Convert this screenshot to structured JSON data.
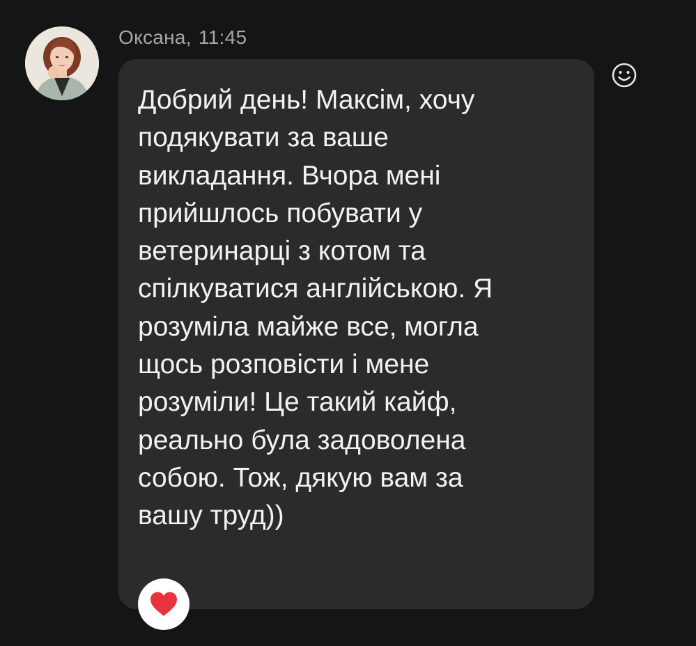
{
  "message": {
    "sender": "Оксана",
    "time": "11:45",
    "text": "Добрий день! Максім, хочу\nподякувати за ваше\nвикладання. Вчора мені\nприйшлось побувати у\nветеринарці з котом та\nспілкуватися англійською. Я\nрозуміла майже все, могла\nщось розповісти і мене\nрозуміли! Це такий кайф,\nреально була задоволена\nсобою. Тож, дякую вам за\nвашу труд))",
    "reaction": "heart",
    "reaction_icon": "heart-icon",
    "add_reaction_icon": "smiley-icon"
  },
  "colors": {
    "background": "#151516",
    "bubble": "#2b2b2d",
    "text": "#f2f2f2",
    "meta_text": "#a7a7ab",
    "reaction_heart": "#e8333d"
  }
}
